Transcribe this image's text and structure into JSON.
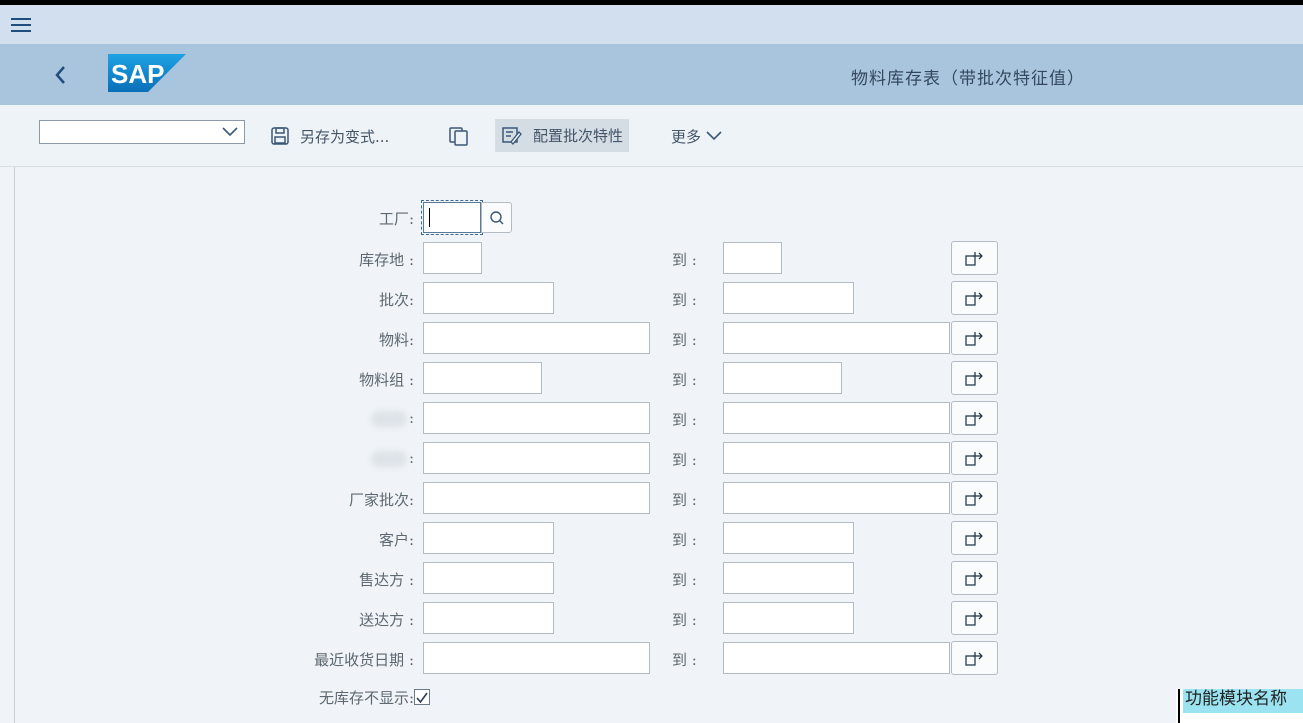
{
  "header": {
    "title": "物料库存表（带批次特征值）",
    "logo_text": "SAP"
  },
  "toolbar": {
    "variant_value": "",
    "save_as_variant": "另存为变式...",
    "config_batch": "配置批次特性",
    "more": "更多"
  },
  "form": {
    "plant_label": "工厂:",
    "to_label": "到 :",
    "rows": [
      {
        "label": "库存地 :"
      },
      {
        "label": "批次:"
      },
      {
        "label": "物料:"
      },
      {
        "label": "物料组 :"
      },
      {
        "label": ":"
      },
      {
        "label": ":"
      },
      {
        "label": "厂家批次:"
      },
      {
        "label": "客户:"
      },
      {
        "label": "售达方 :"
      },
      {
        "label": "送达方 :"
      },
      {
        "label": "最近收货日期 :"
      }
    ],
    "no_stock_label": "无库存不显示:",
    "no_stock_checked": true
  },
  "status": {
    "text": "功能模块名称"
  },
  "icons": {
    "menu": "hamburger-icon",
    "back": "back-icon",
    "save": "save-icon",
    "copy": "copy-icon",
    "config": "edit-icon",
    "search": "search-icon",
    "multiple": "multiple-selection-icon"
  }
}
